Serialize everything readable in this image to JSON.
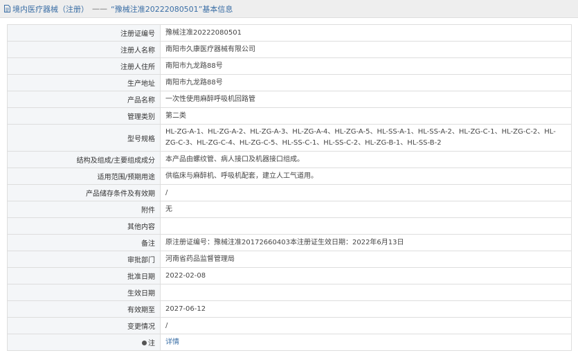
{
  "breadcrumb": {
    "section": "境内医疗器械（注册）",
    "separator": "——",
    "current": "“豫械注准20222080501”基本信息"
  },
  "rows": [
    {
      "label": "注册证编号",
      "value": "豫械注准20222080501"
    },
    {
      "label": "注册人名称",
      "value": "南阳市久康医疗器械有限公司"
    },
    {
      "label": "注册人住所",
      "value": "南阳市九龙路88号"
    },
    {
      "label": "生产地址",
      "value": "南阳市九龙路88号"
    },
    {
      "label": "产品名称",
      "value": "一次性使用麻醉呼吸机回路管"
    },
    {
      "label": "管理类别",
      "value": "第二类"
    },
    {
      "label": "型号规格",
      "value": "HL-ZG-A-1、HL-ZG-A-2、HL-ZG-A-3、HL-ZG-A-4、HL-ZG-A-5、HL-SS-A-1、HL-SS-A-2、HL-ZG-C-1、HL-ZG-C-2、HL-ZG-C-3、HL-ZG-C-4、HL-ZG-C-5、HL-SS-C-1、HL-SS-C-2、HL-ZG-B-1、HL-SS-B-2"
    },
    {
      "label": "结构及组成/主要组成成分",
      "value": "本产品由螺纹管、病人接口及机器接口组成。"
    },
    {
      "label": "适用范围/预期用途",
      "value": "供临床与麻醉机、呼吸机配套，建立人工气道用。"
    },
    {
      "label": "产品储存条件及有效期",
      "value": "/"
    },
    {
      "label": "附件",
      "value": "无"
    },
    {
      "label": "其他内容",
      "value": ""
    },
    {
      "label": "备注",
      "value": "原注册证编号：豫械注准20172660403本注册证生效日期：2022年6月13日"
    },
    {
      "label": "审批部门",
      "value": "河南省药品监督管理局"
    },
    {
      "label": "批准日期",
      "value": "2022-02-08"
    },
    {
      "label": "生效日期",
      "value": ""
    },
    {
      "label": "有效期至",
      "value": "2027-06-12"
    },
    {
      "label": "变更情况",
      "value": "/"
    }
  ],
  "note_row": {
    "label": "注",
    "link": "详情"
  },
  "icons": {
    "header": "document-icon",
    "note": "info-icon"
  },
  "colors": {
    "link": "#3a6ea5",
    "label_bg": "#f4f6f8",
    "border": "#dddddd",
    "header_bg": "#eeeeee"
  }
}
